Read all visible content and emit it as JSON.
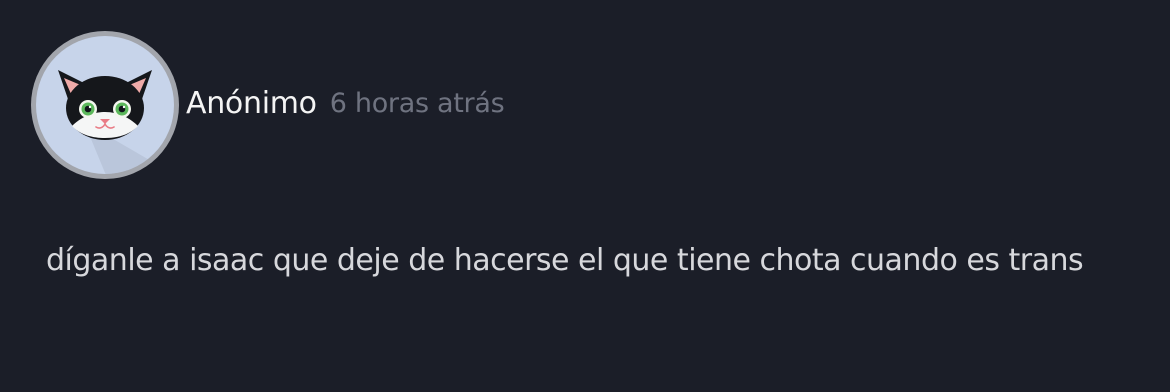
{
  "post": {
    "avatar_icon": "cat-avatar-icon",
    "author": "Anónimo",
    "timestamp": "6 horas atrás",
    "message": "díganle a isaac que deje de hacerse el que tiene chota cuando es trans"
  },
  "colors": {
    "background": "#1b1e28",
    "author_text": "#f4f4f4",
    "timestamp_text": "#6f7380",
    "message_text": "#d7d8dc",
    "avatar_background": "#c7d4ea",
    "avatar_ring": "#a2a5ac"
  }
}
